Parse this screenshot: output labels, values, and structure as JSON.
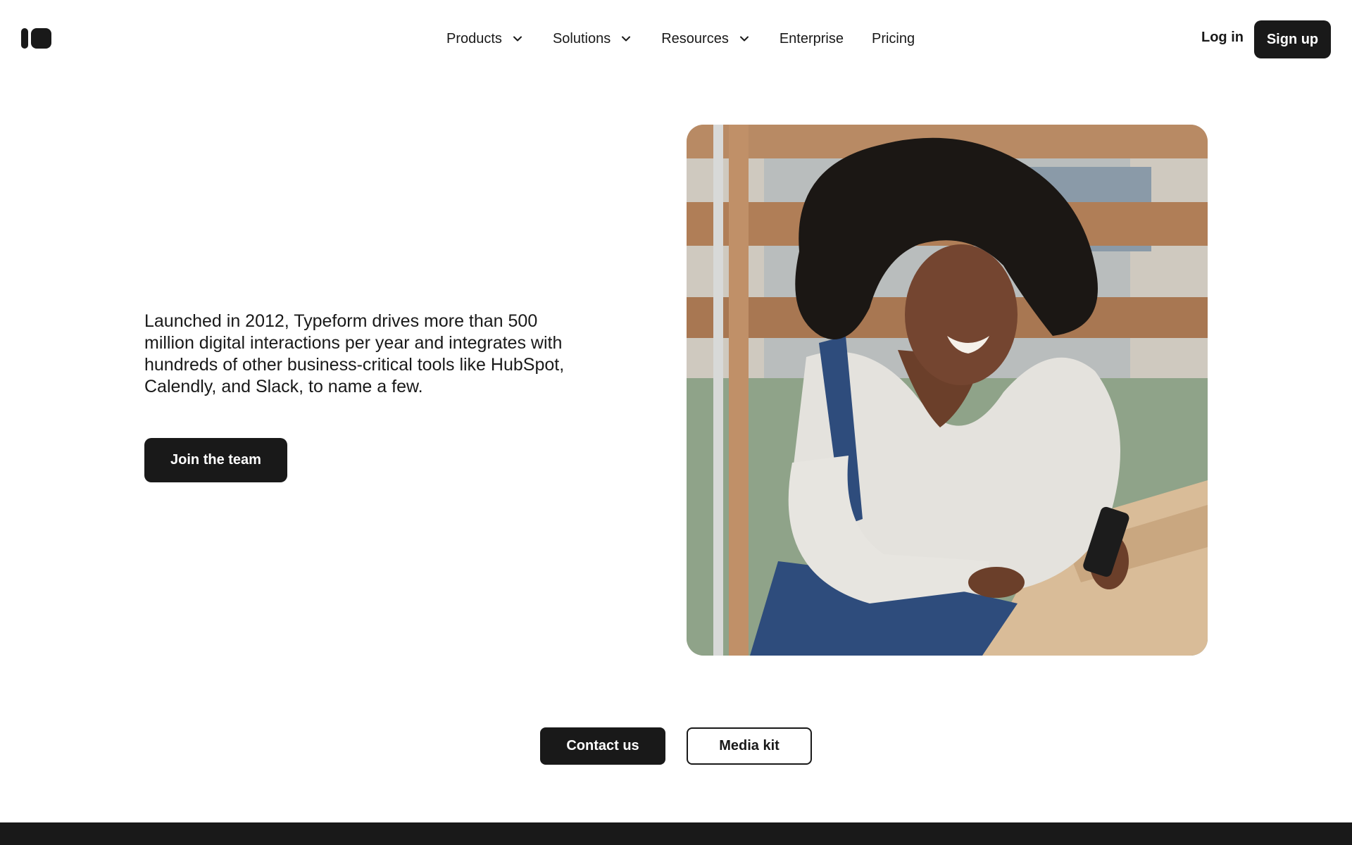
{
  "header": {
    "logo_icon": "typeform-logo-icon",
    "nav": [
      {
        "label": "Products",
        "has_dropdown": true
      },
      {
        "label": "Solutions",
        "has_dropdown": true
      },
      {
        "label": "Resources",
        "has_dropdown": true
      },
      {
        "label": "Enterprise",
        "has_dropdown": false
      },
      {
        "label": "Pricing",
        "has_dropdown": false
      }
    ],
    "login_label": "Log in",
    "signup_label": "Sign up"
  },
  "hero": {
    "body": "Launched in 2012, Typeform drives more than 500 million digital interactions per year and integrates with hundreds of other business-critical tools like HubSpot, Calendly, and Slack, to name a few.",
    "join_label": "Join the team",
    "image_alt": "Smiling woman in overalls looking at her phone"
  },
  "cta": {
    "contact_label": "Contact us",
    "media_label": "Media kit"
  },
  "colors": {
    "primary": "#191919",
    "background": "#ffffff"
  }
}
